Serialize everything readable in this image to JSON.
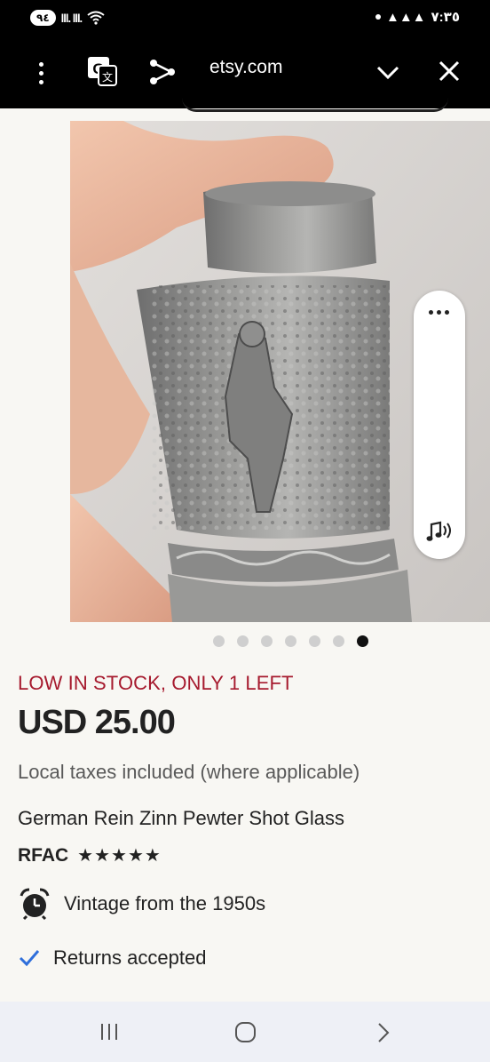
{
  "status_bar": {
    "battery": "٩٤",
    "time": "٧:٣٥"
  },
  "browser": {
    "url": "etsy.com",
    "menu_icon": "more-vert-icon",
    "translate_icon": "google-translate-icon",
    "share_icon": "share-icon",
    "collapse_icon": "chevron-down-icon",
    "close_icon": "close-icon"
  },
  "carousel": {
    "total": 7,
    "active_index": 6
  },
  "product": {
    "stock_notice": "LOW IN STOCK, ONLY 1 LEFT",
    "price": "USD 25.00",
    "taxes_note": "Local taxes included (where applicable)",
    "title": "German Rein Zinn Pewter Shot Glass",
    "shop_name": "RFAC",
    "rating": 5,
    "stars": "★★★★★",
    "vintage_note": "Vintage from the 1950s",
    "returns_note": "Returns accepted"
  },
  "colors": {
    "stock_red": "#a61a2e",
    "check_blue": "#2f6fdb",
    "background": "#f8f7f3"
  }
}
